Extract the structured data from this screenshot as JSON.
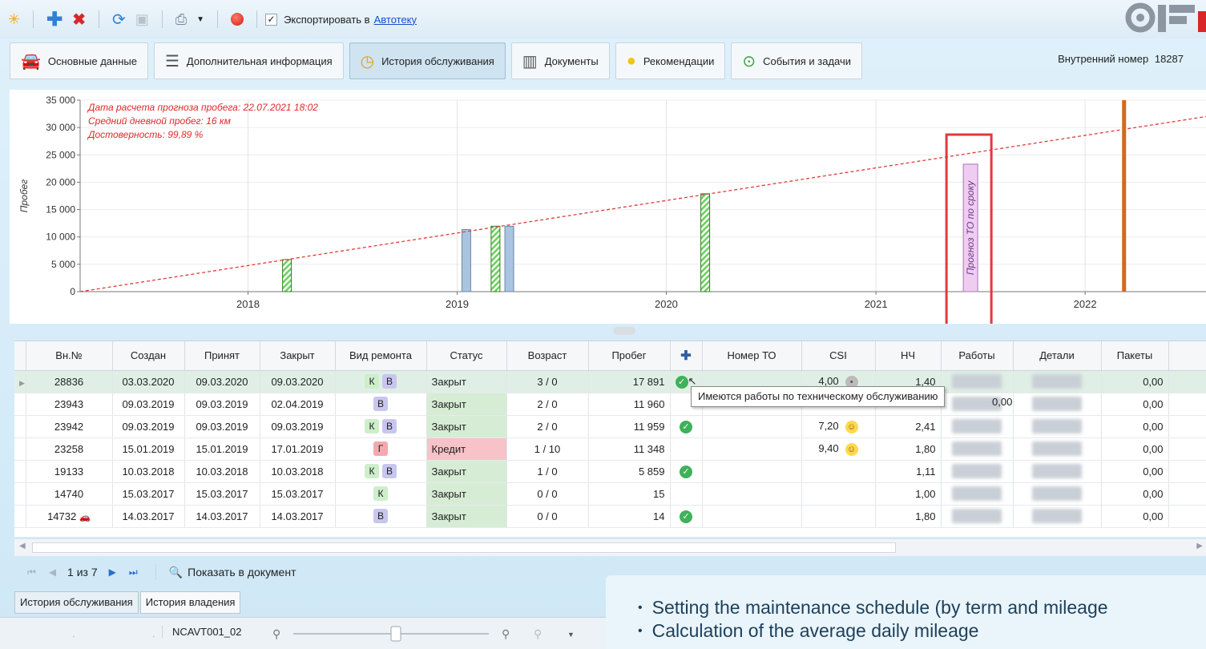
{
  "toolbar": {
    "export_label": "Экспортировать в",
    "export_link": "Автотеку",
    "export_checked": "✓"
  },
  "tabs": [
    {
      "label": "Основные данные",
      "icon": "car-icon"
    },
    {
      "label": "Дополнительная информация",
      "icon": "list-icon"
    },
    {
      "label": "История обслуживания",
      "icon": "clock-icon",
      "active": true
    },
    {
      "label": "Документы",
      "icon": "documents-icon"
    },
    {
      "label": "Рекомендации",
      "icon": "lightbulb-icon"
    },
    {
      "label": "События и задачи",
      "icon": "bell-icon"
    }
  ],
  "inner_number": {
    "label": "Внутренний номер",
    "value": "18287"
  },
  "chart_data": {
    "type": "bar",
    "ylabel": "Пробег",
    "xlabel": "",
    "ylim": [
      0,
      35000
    ],
    "yticks": [
      "35 000",
      "30 000",
      "25 000",
      "20 000",
      "15 000",
      "10 000",
      "5 000",
      "0"
    ],
    "xticks": [
      "2018",
      "2019",
      "2020",
      "2021",
      "2022"
    ],
    "xlim": [
      "2017-03-14",
      "2022-07-31"
    ],
    "annotations": [
      "Дата расчета прогноза пробега: 22.07.2021 18:02",
      "Средний дневной пробег: 16 км",
      "Достоверность: 99,89 %"
    ],
    "series": [
      {
        "name": "",
        "kind": "maintenance",
        "color": "#6ccf5e",
        "points": [
          {
            "date": "2018-03-10",
            "value": 5859
          },
          {
            "date": "2019-03-09",
            "value": 11959
          },
          {
            "date": "2020-03-09",
            "value": 17891
          }
        ]
      },
      {
        "name": "",
        "kind": "repair",
        "color": "#a9c4e0",
        "points": [
          {
            "date": "2019-01-17",
            "value": 11348
          },
          {
            "date": "2019-04-02",
            "value": 11960
          }
        ]
      },
      {
        "name": "",
        "kind": "forecast-trend",
        "color": "#e23a3a",
        "points": [
          {
            "date": "2017-03-14",
            "value": 0
          },
          {
            "date": "2022-07-31",
            "value": 32000
          }
        ]
      }
    ],
    "forecast_label": "Прогноз ТО по сроку",
    "forecast_date": "2021-06-15",
    "forecast_value": 23300,
    "current_date": "2022-03-10",
    "current_color": "#d2691e"
  },
  "grid": {
    "columns": [
      "Вн.№",
      "Создан",
      "Принят",
      "Закрыт",
      "Вид ремонта",
      "Статус",
      "Возраст",
      "Пробег",
      "",
      "Номер ТО",
      "CSI",
      "НЧ",
      "Работы",
      "Детали",
      "Пакеты"
    ],
    "rows": [
      {
        "num": "28836",
        "created": "03.03.2020",
        "accepted": "09.03.2020",
        "closed": "09.03.2020",
        "types": [
          "К",
          "В"
        ],
        "status": "Закрыт",
        "age": "3 / 0",
        "mileage": "17 891",
        "to_done": true,
        "to_num": "",
        "csi": "4,00",
        "csi_mood": "neutral",
        "hours": "1,40",
        "packages": "0,00"
      },
      {
        "num": "23943",
        "created": "09.03.2019",
        "accepted": "09.03.2019",
        "closed": "02.04.2019",
        "types": [
          "В"
        ],
        "status": "Закрыт",
        "age": "2 / 0",
        "mileage": "11 960",
        "to_done": false,
        "to_num": "",
        "csi": "",
        "csi_mood": "",
        "hours": "",
        "packages": "0,00"
      },
      {
        "num": "23942",
        "created": "09.03.2019",
        "accepted": "09.03.2019",
        "closed": "09.03.2019",
        "types": [
          "К",
          "В"
        ],
        "status": "Закрыт",
        "age": "2 / 0",
        "mileage": "11 959",
        "to_done": true,
        "to_num": "",
        "csi": "7,20",
        "csi_mood": "happy",
        "hours": "2,41",
        "packages": "0,00"
      },
      {
        "num": "23258",
        "created": "15.01.2019",
        "accepted": "15.01.2019",
        "closed": "17.01.2019",
        "types": [
          "Г"
        ],
        "status": "Кредит",
        "age": "1 / 10",
        "mileage": "11 348",
        "to_done": false,
        "to_num": "",
        "csi": "9,40",
        "csi_mood": "happy",
        "hours": "1,80",
        "packages": "0,00"
      },
      {
        "num": "19133",
        "created": "10.03.2018",
        "accepted": "10.03.2018",
        "closed": "10.03.2018",
        "types": [
          "К",
          "В"
        ],
        "status": "Закрыт",
        "age": "1 / 0",
        "mileage": "5 859",
        "to_done": true,
        "to_num": "",
        "csi": "",
        "csi_mood": "",
        "hours": "1,11",
        "packages": "0,00"
      },
      {
        "num": "14740",
        "created": "15.03.2017",
        "accepted": "15.03.2017",
        "closed": "15.03.2017",
        "types": [
          "К"
        ],
        "status": "Закрыт",
        "age": "0 / 0",
        "mileage": "15",
        "to_done": false,
        "to_num": "",
        "csi": "",
        "csi_mood": "",
        "hours": "1,00",
        "packages": "0,00"
      },
      {
        "num": "14732",
        "created": "14.03.2017",
        "accepted": "14.03.2017",
        "closed": "14.03.2017",
        "types": [
          "В"
        ],
        "status": "Закрыт",
        "age": "0 / 0",
        "mileage": "14",
        "to_done": true,
        "to_num": "",
        "csi": "",
        "csi_mood": "",
        "hours": "1,80",
        "packages": "0,00"
      }
    ]
  },
  "tooltip": {
    "text": "Имеются работы по техническому обслуживанию",
    "extra_value": "0,00"
  },
  "pager": {
    "text": "1 из 7",
    "show_in_doc": "Показать в документ"
  },
  "bottom_tabs": [
    "История обслуживания",
    "История владения"
  ],
  "status": {
    "code": "NCAVT001_02"
  },
  "info_panel": {
    "items": [
      "Setting the maintenance schedule (by term and mileage",
      "Calculation of the average daily mileage"
    ]
  }
}
